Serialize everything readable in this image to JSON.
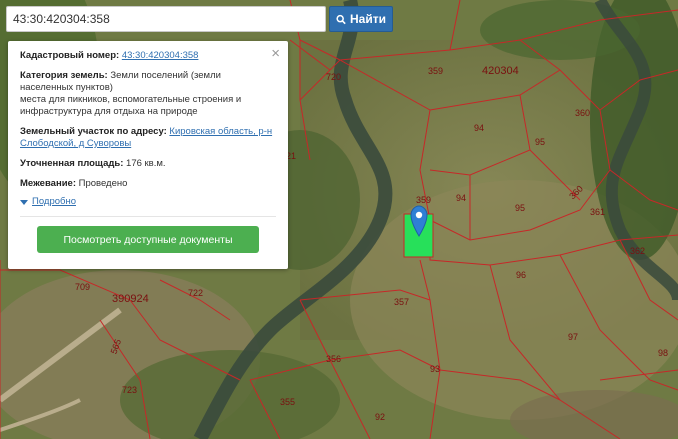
{
  "search": {
    "value": "43:30:420304:358",
    "button_label": "Найти",
    "button_icon": "search-icon"
  },
  "info_panel": {
    "cadastral_label": "Кадастровый номер:",
    "cadastral_value": "43:30:420304:358",
    "category_label": "Категория земель:",
    "category_value": "Земли поселений (земли населенных пунктов)",
    "category_extra": "места для пикников, вспомогательные строения и инфраструктура для отдыха на природе",
    "address_label": "Земельный участок по адресу:",
    "address_value": "Кировская область, р-н Слободской, д Суворовы",
    "area_label": "Уточненная площадь:",
    "area_value": "176 кв.м.",
    "survey_label": "Межевание:",
    "survey_value": "Проведено",
    "more_label": "Подробно",
    "docs_button": "Посмотреть доступные документы",
    "close_icon": "close-icon"
  },
  "map": {
    "quarter_labels": [
      "420304",
      "390924"
    ],
    "plot_labels": [
      "720",
      "359",
      "360",
      "94",
      "95",
      "21",
      "359",
      "94",
      "95",
      "360",
      "361",
      "362",
      "96",
      "709",
      "722",
      "357",
      "97",
      "356",
      "98",
      "93",
      "723",
      "355",
      "92",
      "565"
    ],
    "marker_icon": "map-pin-icon",
    "colors": {
      "boundary": "#c62828",
      "selected_parcel": "#27e05a",
      "marker": "#2f7fd4",
      "river": "#3a4a3c"
    }
  }
}
